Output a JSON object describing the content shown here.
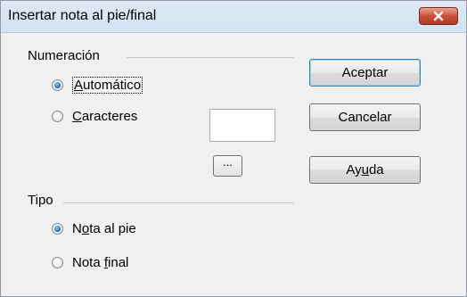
{
  "window": {
    "title": "Insertar nota al pie/final"
  },
  "numbering": {
    "group_label": "Numeración",
    "auto": {
      "pre": "",
      "key": "A",
      "post": "utomático",
      "checked": true
    },
    "chars": {
      "pre": "",
      "key": "C",
      "post": "aracteres",
      "checked": false,
      "value": ""
    },
    "browse_label": "..."
  },
  "type": {
    "group_label": "Tipo",
    "footnote": {
      "pre": "N",
      "key": "o",
      "post": "ta al pie",
      "checked": true
    },
    "endnote": {
      "pre": "Nota ",
      "key": "f",
      "post": "inal",
      "checked": false
    }
  },
  "buttons": {
    "ok": "Aceptar",
    "cancel": "Cancelar",
    "help_pre": "Ay",
    "help_key": "u",
    "help_post": "da"
  },
  "icons": {
    "close": "close-icon"
  }
}
